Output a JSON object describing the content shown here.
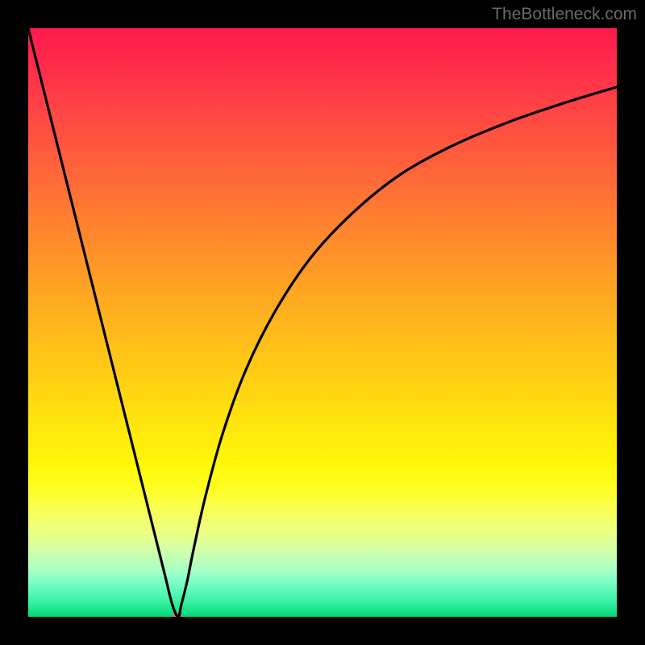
{
  "watermark": "TheBottleneck.com",
  "chart_data": {
    "type": "line",
    "title": "",
    "xlabel": "",
    "ylabel": "",
    "xlim": [
      0,
      100
    ],
    "ylim": [
      0,
      100
    ],
    "x": [
      0,
      4,
      8,
      12,
      16,
      20,
      23,
      24.5,
      25.5,
      26,
      27,
      28,
      30,
      33,
      37,
      42,
      48,
      55,
      63,
      72,
      82,
      92,
      100
    ],
    "values": [
      100,
      84,
      68,
      52,
      36,
      20,
      8,
      2,
      0,
      2,
      6,
      11,
      20,
      31,
      42,
      52,
      61,
      68.5,
      75,
      80,
      84.2,
      87.6,
      90
    ],
    "marker": {
      "x": 25.3,
      "y": 0.3,
      "color": "#d6757a",
      "rx": 6,
      "ry": 4
    },
    "background_gradient": "red-yellow-green vertical"
  }
}
